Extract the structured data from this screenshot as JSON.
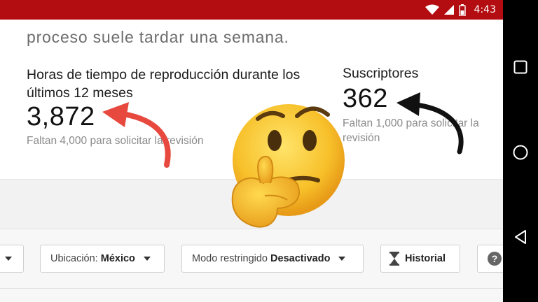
{
  "status_bar": {
    "time": "4:43",
    "icons": [
      "wifi-icon",
      "cell-signal-icon",
      "battery-icon"
    ],
    "color": "#b30d12"
  },
  "intro": {
    "text": "proceso suele tardar una semana."
  },
  "watch_time": {
    "title": "Horas de tiempo de reproducción durante los últimos 12 meses",
    "value": "3,872",
    "note": "Faltan 4,000 para solicitar la revisión"
  },
  "subscribers": {
    "title": "Suscriptores",
    "value": "362",
    "note": "Faltan 1,000 para solicitar la revisión"
  },
  "filters": {
    "location_label": "Ubicación:",
    "location_value": "México",
    "restricted_label": "Modo restringido",
    "restricted_value": "Desactivado",
    "history_label": "Historial",
    "help_label": "?"
  },
  "nav_bar": {
    "buttons": [
      "recents-square-icon",
      "home-circle-icon",
      "back-triangle-icon"
    ]
  },
  "overlay": {
    "emoji": "thinking-face-emoji",
    "arrow_colors": [
      "#e8493f",
      "#111111"
    ]
  }
}
